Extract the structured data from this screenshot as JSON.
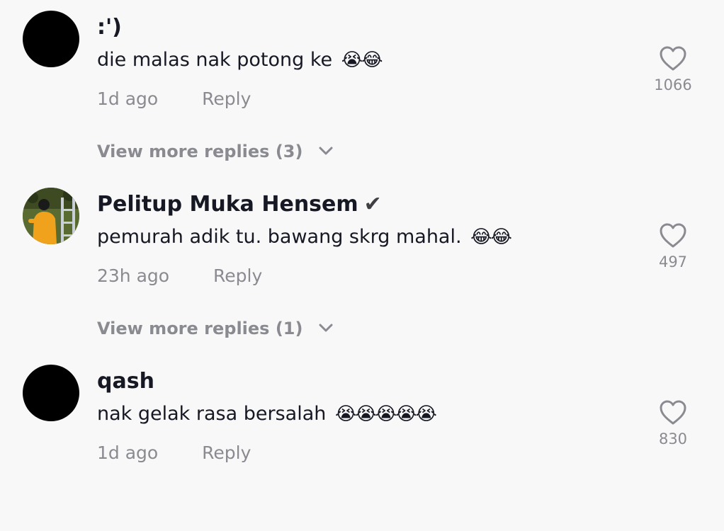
{
  "comments": [
    {
      "username": ":')",
      "verified": false,
      "text": "die malas nak potong ke",
      "emojis": "😭😂",
      "timestamp": "1d ago",
      "reply_label": "Reply",
      "like_count": "1066",
      "view_more": "View more replies (3)",
      "avatar": "black-avatar"
    },
    {
      "username": "Pelitup Muka Hensem",
      "verified": true,
      "verified_mark": "✔",
      "text": "pemurah adik tu. bawang skrg mahal.",
      "emojis": "😂😂",
      "timestamp": "23h ago",
      "reply_label": "Reply",
      "like_count": "497",
      "view_more": "View more replies (1)",
      "avatar": "photo-avatar-person-in-orange-with-ladder"
    },
    {
      "username": "qash",
      "verified": false,
      "text": "nak gelak rasa bersalah",
      "emojis": "😭😭😭😭😭",
      "timestamp": "1d ago",
      "reply_label": "Reply",
      "like_count": "830",
      "avatar": "black-avatar"
    }
  ],
  "icons": {
    "like": "heart-outline-icon",
    "expand": "chevron-down-icon",
    "verified": "checkmark-icon"
  },
  "colors": {
    "background": "#f8f8f8",
    "text_primary": "#161823",
    "text_secondary": "#8a8b91"
  }
}
